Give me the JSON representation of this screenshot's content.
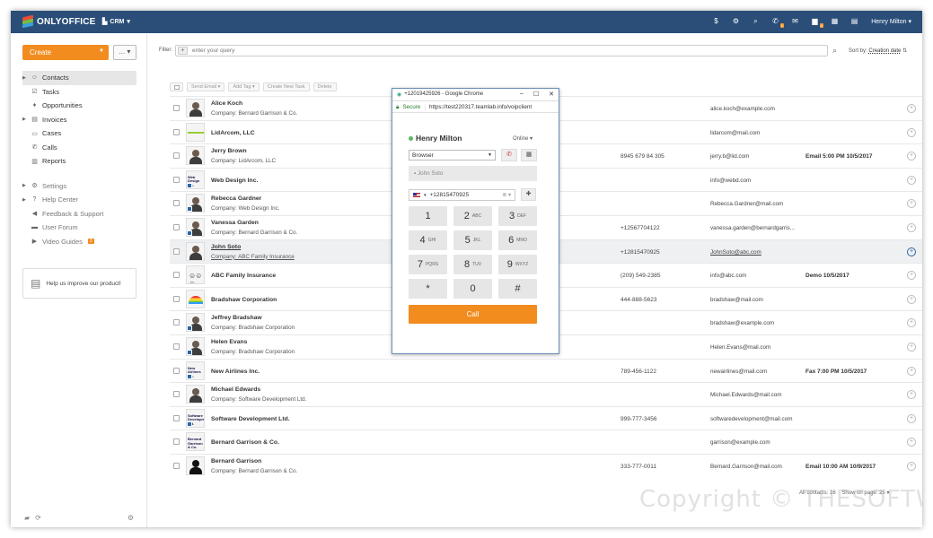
{
  "topbar": {
    "brand": "ONLYOFFICE",
    "module": "CRM",
    "user": "Henry Milton",
    "chat_badge": "1",
    "calls_badge": "4"
  },
  "sidebar": {
    "create_label": "Create",
    "more_label": "...",
    "nav": [
      {
        "label": "Contacts",
        "icon": "contacts-icon"
      },
      {
        "label": "Tasks",
        "icon": "tasks-icon"
      },
      {
        "label": "Opportunities",
        "icon": "opportunities-icon"
      },
      {
        "label": "Invoices",
        "icon": "invoices-icon"
      },
      {
        "label": "Cases",
        "icon": "cases-icon"
      },
      {
        "label": "Calls",
        "icon": "calls-icon"
      },
      {
        "label": "Reports",
        "icon": "reports-icon"
      }
    ],
    "nav2": [
      {
        "label": "Settings"
      },
      {
        "label": "Help Center"
      },
      {
        "label": "Feedback & Support"
      },
      {
        "label": "User Forum"
      },
      {
        "label": "Video Guides"
      }
    ],
    "video_badge": "2",
    "improve_label": "Help us improve our product!"
  },
  "filter": {
    "label": "Filter:",
    "placeholder": "enter your query",
    "sort_label": "Sort by:",
    "sort_value": "Creation date"
  },
  "actions": [
    "Send Email",
    "Add Tag",
    "Create New Task",
    "Delete"
  ],
  "contacts": [
    {
      "name": "Alice Koch",
      "company": "Company: Bernard Garrison & Co.",
      "phone": "",
      "email": "alice.koch@example.com",
      "task": "",
      "avatar": "person"
    },
    {
      "name": "LidArcom, LLC",
      "company": "",
      "phone": "",
      "email": "lidarcom@mail.com",
      "task": "",
      "avatar": "lid"
    },
    {
      "name": "Jerry Brown",
      "company": "Company: LidArcom, LLC",
      "phone": "8945 679 84 305",
      "email": "jerry.b@lid.com",
      "task": "Email 5:00 PM 10/5/2017",
      "avatar": "person"
    },
    {
      "name": "Web Design Inc.",
      "company": "",
      "phone": "",
      "email": "info@webd.com",
      "task": "",
      "avatar": "web"
    },
    {
      "name": "Rebecca Gardner",
      "company": "Company: Web Design Inc.",
      "phone": "",
      "email": "Rebecca.Gardner@mail.com",
      "task": "",
      "avatar": "person"
    },
    {
      "name": "Vanessa Garden",
      "company": "Company: Bernard Garrison & Co.",
      "phone": "+12567704122",
      "email": "vanessa.garden@bernardgarris...",
      "task": "",
      "avatar": "person"
    },
    {
      "name": "John Soto",
      "company": "Company: ABC Family Insurance",
      "phone": "+12815470925",
      "email": "JohnSoto@abc.com",
      "task": "",
      "avatar": "person"
    },
    {
      "name": "ABC Family Insurance",
      "company": "",
      "phone": "(209) 549-2385",
      "email": "info@abc.com",
      "task": "Demo 10/5/2017",
      "avatar": "people"
    },
    {
      "name": "Bradshaw Corporation",
      "company": "",
      "phone": "444-888-5623",
      "email": "bradshaw@mail.com",
      "task": "",
      "avatar": "rainbow"
    },
    {
      "name": "Jeffrey Bradshaw",
      "company": "Company: Bradshaw Corporation",
      "phone": "",
      "email": "bradshaw@example.com",
      "task": "",
      "avatar": "person"
    },
    {
      "name": "Helen Evans",
      "company": "Company: Bradshaw Corporation",
      "phone": "",
      "email": "Helen.Evans@mail.com",
      "task": "",
      "avatar": "person"
    },
    {
      "name": "New Airlines Inc.",
      "company": "",
      "phone": "789-456-1122",
      "email": "newairlines@mail.com",
      "task": "Fax 7:00 PM 10/5/2017",
      "avatar": "air"
    },
    {
      "name": "Michael Edwards",
      "company": "Company: Software Development Ltd.",
      "phone": "",
      "email": "Michael.Edwards@mail.com",
      "task": "",
      "avatar": "person"
    },
    {
      "name": "Software Development Ltd.",
      "company": "",
      "phone": "999-777-3456",
      "email": "softwaredevelopment@mail.com",
      "task": "",
      "avatar": "soft"
    },
    {
      "name": "Bernard Garrison & Co.",
      "company": "",
      "phone": "",
      "email": "garrison@example.com",
      "task": "",
      "avatar": "bern"
    },
    {
      "name": "Bernard Garrison",
      "company": "Company: Bernard Garrison & Co.",
      "phone": "333-777-0011",
      "email": "Bernard.Garrison@mail.com",
      "task": "Email 10:00 AM 10/9/2017",
      "avatar": "silhouette"
    }
  ],
  "footer": {
    "total_label": "All contacts:",
    "total_value": "16",
    "per_page_label": "Show on page:",
    "per_page_value": "25"
  },
  "watermark": "Copyright © THESOFTW",
  "popup": {
    "window_title": "+12019425926 - Google Chrome",
    "secure_label": "Secure",
    "url": "https://test220317.teamlab.info/voipclient",
    "agent": "Henry Milton",
    "status": "Online",
    "device": "Browser",
    "contact": "John Soto",
    "number": "+12815470925",
    "keys": [
      {
        "digit": "1",
        "letters": ""
      },
      {
        "digit": "2",
        "letters": "ABC"
      },
      {
        "digit": "3",
        "letters": "DEF"
      },
      {
        "digit": "4",
        "letters": "GHI"
      },
      {
        "digit": "5",
        "letters": "JKL"
      },
      {
        "digit": "6",
        "letters": "MNO"
      },
      {
        "digit": "7",
        "letters": "PQRS"
      },
      {
        "digit": "8",
        "letters": "TUV"
      },
      {
        "digit": "9",
        "letters": "WXYZ"
      },
      {
        "digit": "*",
        "letters": ""
      },
      {
        "digit": "0",
        "letters": ""
      },
      {
        "digit": "#",
        "letters": ""
      }
    ],
    "call_label": "Call"
  },
  "colors": {
    "topbar": "#2a4e78",
    "accent": "#f28c1f"
  }
}
